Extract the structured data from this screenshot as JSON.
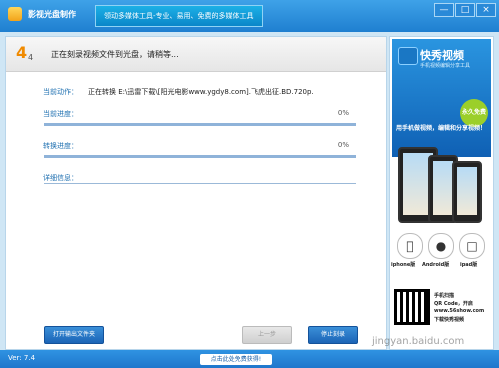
{
  "window": {
    "title": "影视光盘制作",
    "slogan": "领动多媒体工具-专业、易用、免费的多媒体工具",
    "controls": [
      "—",
      "□",
      "×"
    ]
  },
  "step": {
    "current": "4",
    "total": "4",
    "text": "正在刻录视频文件到光盘，请稍等..."
  },
  "progress": {
    "current_action_label": "当前动作：",
    "current_action_value": "正在转换 E:\\迅雷下载\\[阳光电影www.ygdy8.com].飞虎出征.BD.720p.",
    "current_progress_label": "当前进度：",
    "current_progress_percent": "0%",
    "current_progress_fraction": 0,
    "convert_progress_label": "转换进度：",
    "convert_progress_percent": "0%",
    "convert_progress_fraction": 0,
    "detail_label": "详细信息："
  },
  "buttons": {
    "open_output_folder": "打开输出文件夹",
    "prev_step": "上一步",
    "stop_burn": "停止刻录"
  },
  "ad": {
    "title": "快秀视频",
    "subtitle": "手机视频编辑分享工具",
    "badge": "永久免费",
    "promo": "用手机做视频，编辑和分享视频！",
    "platforms": [
      "iphone版",
      "Android版",
      "ipad版"
    ],
    "qr_lines": [
      "手机扫描",
      "QR Code，开启",
      "www.56show.com",
      "下载快秀视频"
    ]
  },
  "status": {
    "version": "Ver: 7.4",
    "promo_button": "点击此处免费获得!",
    "watermark": "jingyan.baidu.com"
  },
  "colors": {
    "titlebar": "#2a8ad8",
    "accent": "#1d6fb0",
    "step_number": "#f08a00",
    "progress_bar": "#8fb3d9"
  }
}
